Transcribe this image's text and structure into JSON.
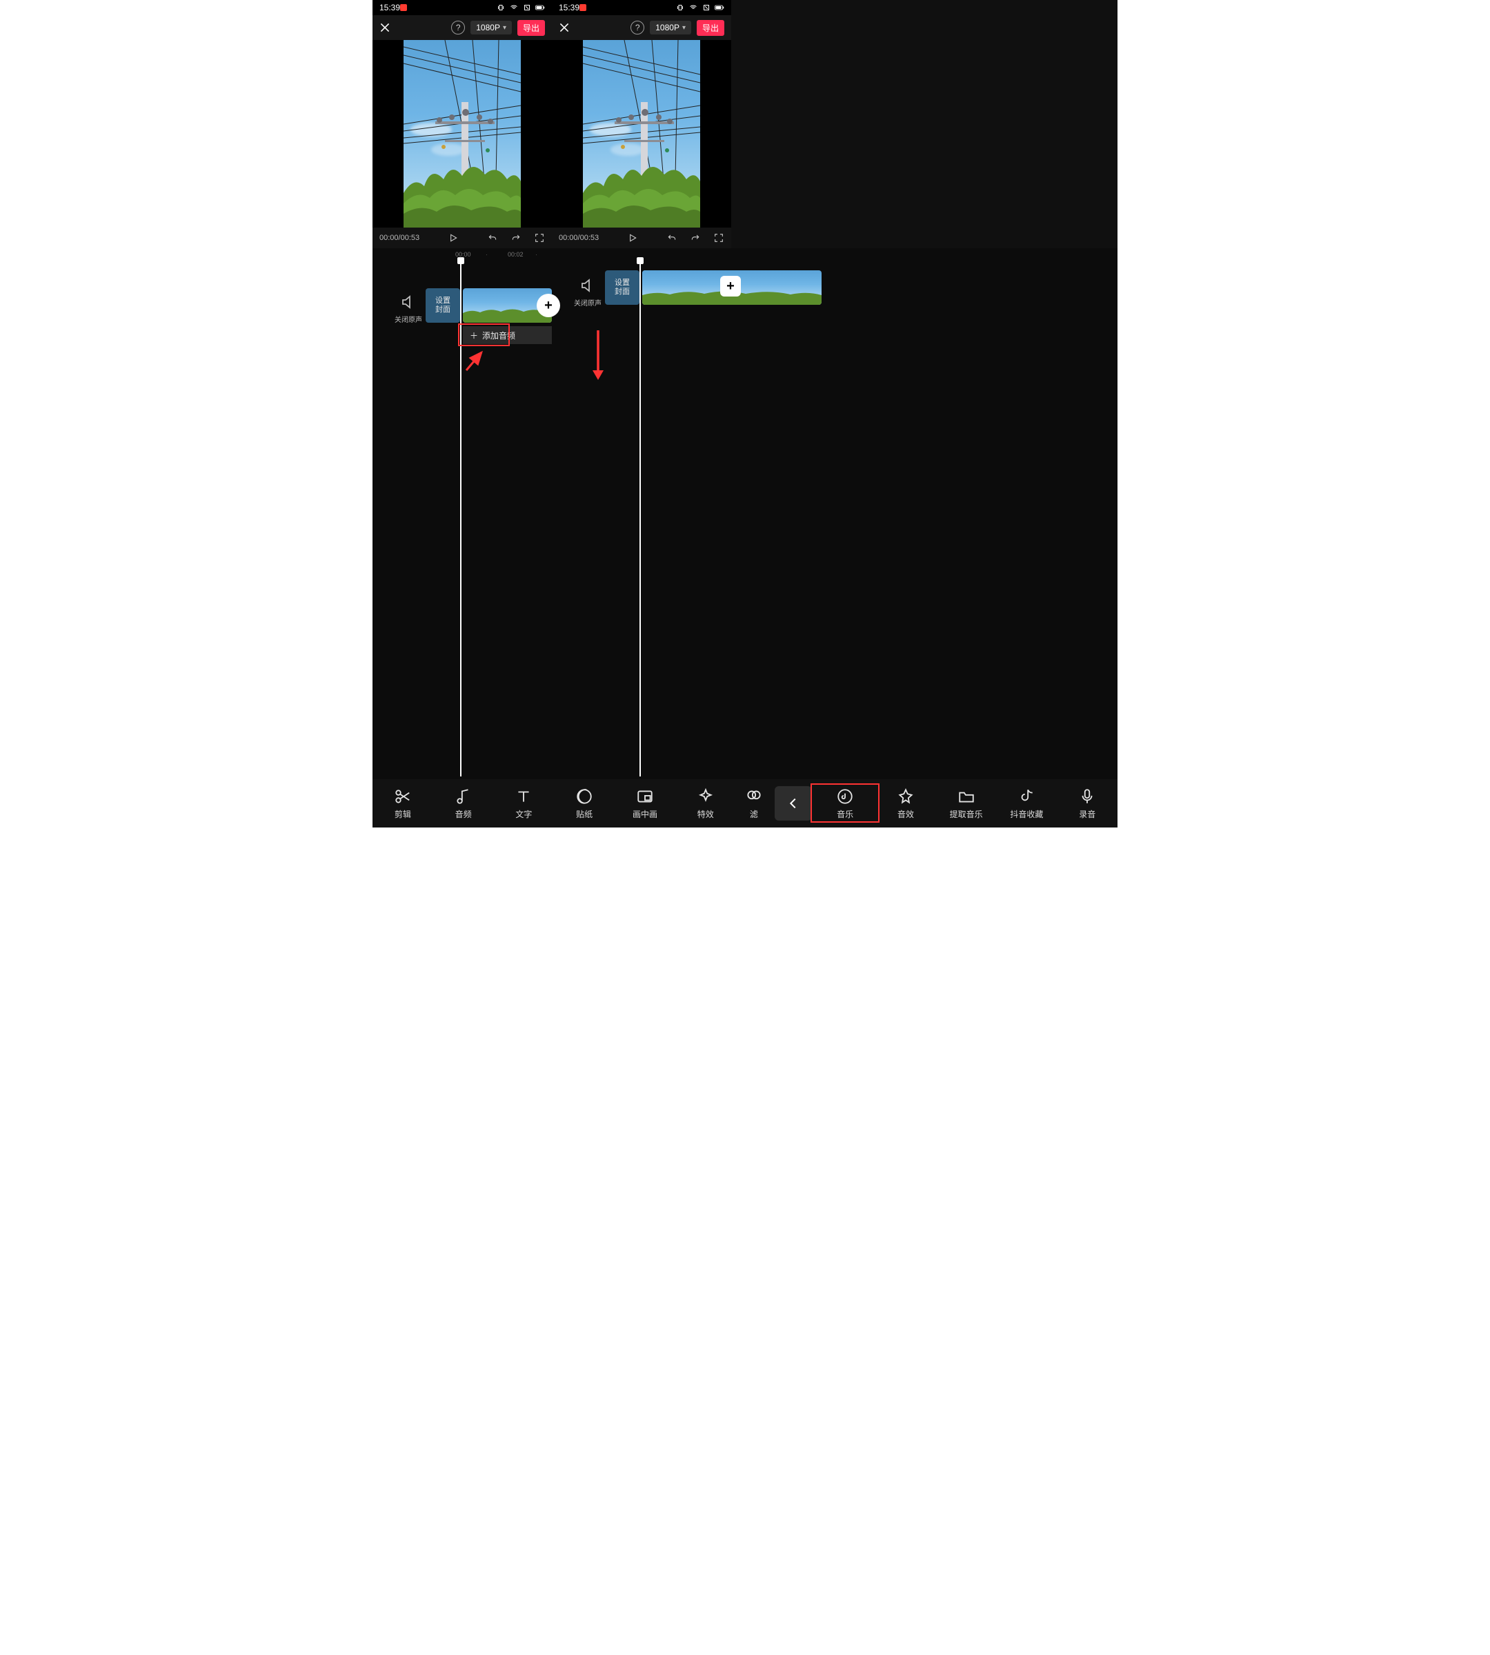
{
  "status": {
    "time": "15:39"
  },
  "toolbar": {
    "resolution": "1080P",
    "export_label": "导出"
  },
  "playbar": {
    "time": "00:00/00:53"
  },
  "ruler": {
    "t0": "00:00",
    "t2": "00:02"
  },
  "mute_label": "关闭原声",
  "cover_label": "设置\n封面",
  "add_audio_label": "添加音频",
  "bottom": {
    "left": [
      "剪辑",
      "音频",
      "文字",
      "贴纸",
      "画中画",
      "特效",
      "滤"
    ],
    "right": [
      "音乐",
      "音效",
      "提取音乐",
      "抖音收藏",
      "录音"
    ]
  },
  "colors": {
    "accent": "#ff2d55",
    "highlight": "#f33"
  }
}
